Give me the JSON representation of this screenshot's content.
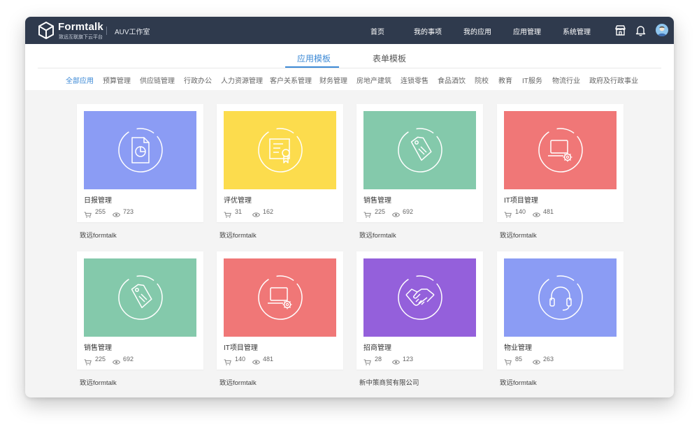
{
  "header": {
    "brand": "Formtalk",
    "brand_sub": "致远互联旗下云平台",
    "workspace": "AUV工作室",
    "nav": [
      {
        "label": "首页"
      },
      {
        "label": "我的事项"
      },
      {
        "label": "我的应用"
      },
      {
        "label": "应用管理"
      },
      {
        "label": "系统管理"
      }
    ],
    "icons": [
      "store-icon",
      "bell-icon",
      "user-avatar"
    ]
  },
  "tabs": [
    {
      "label": "应用模板",
      "active": true
    },
    {
      "label": "表单模板",
      "active": false
    }
  ],
  "categories": [
    {
      "label": "全部应用",
      "active": true
    },
    {
      "label": "预算管理"
    },
    {
      "label": "供应链管理"
    },
    {
      "label": "行政办公"
    },
    {
      "label": "人力资源管理"
    },
    {
      "label": "客户关系管理"
    },
    {
      "label": "财务管理"
    },
    {
      "label": "房地产建筑"
    },
    {
      "label": "连锁零售"
    },
    {
      "label": "食品酒饮"
    },
    {
      "label": "院校"
    },
    {
      "label": "教育"
    },
    {
      "label": "IT服务"
    },
    {
      "label": "物流行业"
    },
    {
      "label": "政府及行政事业"
    }
  ],
  "templates": [
    {
      "title": "日报管理",
      "installs": "255",
      "views": "723",
      "author": "致远formtalk",
      "color": "#8b9cf4",
      "icon": "report-chart-icon"
    },
    {
      "title": "评优管理",
      "installs": "31",
      "views": "162",
      "author": "致远formtalk",
      "color": "#fcdc4d",
      "icon": "certificate-icon"
    },
    {
      "title": "销售管理",
      "installs": "225",
      "views": "692",
      "author": "致远formtalk",
      "color": "#84c9ab",
      "icon": "price-tag-icon"
    },
    {
      "title": "IT项目管理",
      "installs": "140",
      "views": "481",
      "author": "致远formtalk",
      "color": "#f07777",
      "icon": "laptop-gear-icon"
    },
    {
      "title": "销售管理",
      "installs": "225",
      "views": "692",
      "author": "致远formtalk",
      "color": "#84c9ab",
      "icon": "price-tag-icon"
    },
    {
      "title": "IT项目管理",
      "installs": "140",
      "views": "481",
      "author": "致远formtalk",
      "color": "#f07777",
      "icon": "laptop-gear-icon"
    },
    {
      "title": "招商管理",
      "installs": "28",
      "views": "123",
      "author": "新中策商贸有限公司",
      "color": "#9460db",
      "icon": "handshake-icon"
    },
    {
      "title": "物业管理",
      "installs": "85",
      "views": "263",
      "author": "致远formtalk",
      "color": "#8b9cf4",
      "icon": "headset-icon"
    }
  ]
}
